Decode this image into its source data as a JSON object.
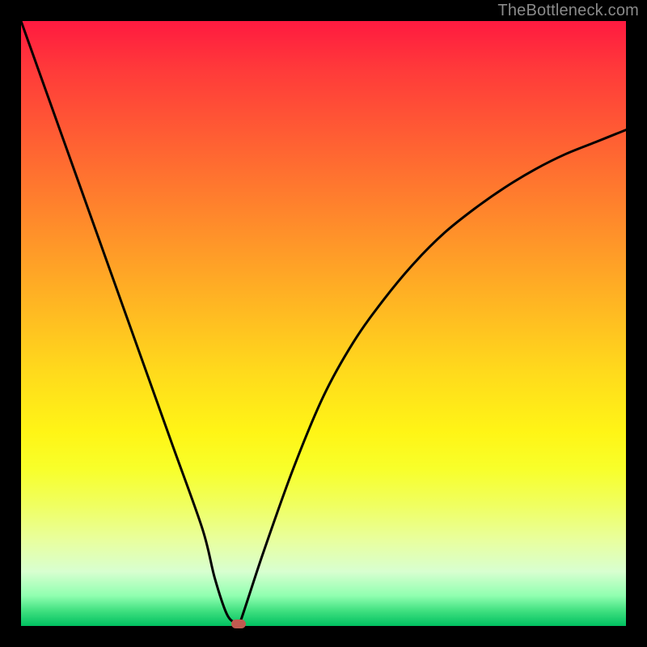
{
  "watermark": "TheBottleneck.com",
  "colors": {
    "frame": "#000000",
    "gradient_top": "#ff1a40",
    "gradient_bottom": "#00c060",
    "curve": "#000000",
    "marker": "#c05a50",
    "watermark_text": "#8a8a8a"
  },
  "chart_data": {
    "type": "line",
    "title": "",
    "xlabel": "",
    "ylabel": "",
    "xlim": [
      0,
      100
    ],
    "ylim": [
      0,
      100
    ],
    "x": [
      0,
      5,
      10,
      15,
      20,
      25,
      30,
      32,
      34,
      35.5,
      36,
      40,
      45,
      50,
      55,
      60,
      65,
      70,
      75,
      80,
      85,
      90,
      95,
      100
    ],
    "y": [
      100,
      86,
      72,
      58,
      44,
      30,
      16,
      8,
      2,
      0.4,
      0,
      12,
      26,
      38,
      47,
      54,
      60,
      65,
      69,
      72.5,
      75.5,
      78,
      80,
      82
    ],
    "marker": {
      "x": 36,
      "y": 0
    },
    "annotations": [],
    "grid": false,
    "legend": false
  }
}
